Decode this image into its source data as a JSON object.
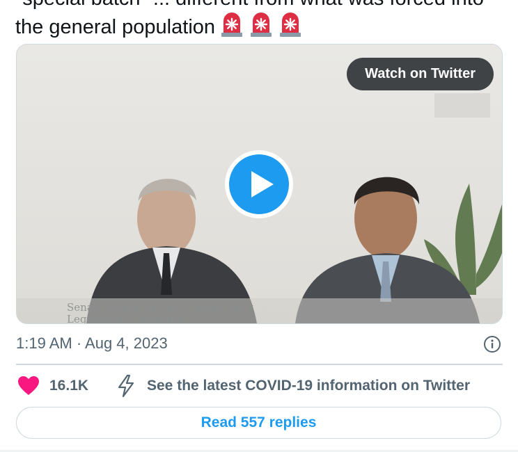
{
  "tweet": {
    "text_line1": "\"special batch\" ... different from what was forced into",
    "text_line2": "the general population",
    "emoji_icons": [
      "police-light-icon",
      "police-light-icon",
      "police-light-icon"
    ]
  },
  "media": {
    "watch_label": "Watch on Twitter",
    "caption_line1": "Senate Education and Employment",
    "caption_line2": "Legislation Committee",
    "play_icon": "play-icon"
  },
  "meta": {
    "timestamp": "1:19 AM · Aug 4, 2023",
    "info_icon": "info-icon"
  },
  "actions": {
    "like_count": "16.1K",
    "heart_icon": "heart-icon",
    "bolt_icon": "lightning-bolt-icon",
    "covid_link": "See the latest COVID-19 information on Twitter"
  },
  "replies": {
    "label": "Read 557 replies"
  },
  "colors": {
    "accent": "#1d9bf0",
    "heart": "#f91880",
    "secondary_text": "#536471",
    "border": "#cfd9de"
  }
}
